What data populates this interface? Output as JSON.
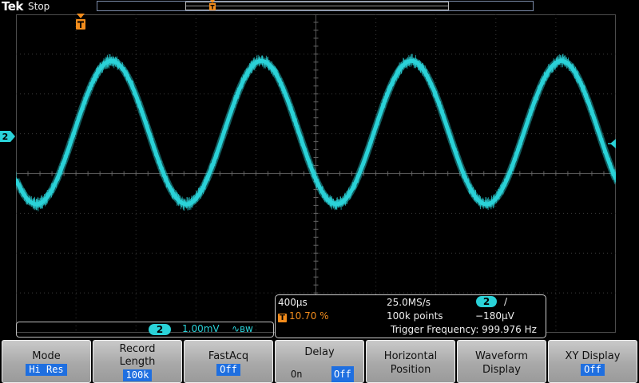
{
  "header": {
    "brand": "Tek",
    "acquisition_state": "Stop"
  },
  "markers": {
    "trigger_position_icon": "T",
    "channel_icon": "2"
  },
  "channel_readout": {
    "channel": "2",
    "volts_per_div": "1.00mV",
    "bandwidth_icon": "∿ʙᴡ"
  },
  "horizontal_readout": {
    "time_per_div": "400µs",
    "trigger_position_icon": "T",
    "trigger_position": "10.70 %",
    "sample_rate": "25.0MS/s",
    "record_points": "100k points",
    "trigger_source": "2",
    "trigger_slope_icon": "∕",
    "trigger_level": "−180µV",
    "trigger_frequency": "Trigger Frequency: 999.976 Hz"
  },
  "menu": {
    "mode": {
      "label": "Mode",
      "value": "Hi Res"
    },
    "record_length": {
      "label_line1": "Record",
      "label_line2": "Length",
      "value": "100k"
    },
    "fastacq": {
      "label": "FastAcq",
      "value": "Off"
    },
    "delay": {
      "label": "Delay",
      "option_on": "On",
      "option_off": "Off"
    },
    "horizontal_position": {
      "label_line1": "Horizontal",
      "label_line2": "Position"
    },
    "waveform_display": {
      "label_line1": "Waveform",
      "label_line2": "Display"
    },
    "xy_display": {
      "label": "XY Display",
      "value": "Off"
    }
  },
  "waveform": {
    "channel": "2",
    "color": "#2ad2d8",
    "shape": "sine",
    "frequency_hz": 999.976,
    "time_per_div_s": 0.0004,
    "volts_per_div_v": 0.001,
    "amplitude_div": 1.8,
    "offset_div": 1.03,
    "horizontal_divs": 10,
    "vertical_divs": 8
  },
  "colors": {
    "channel2": "#2ad2d8",
    "trigger": "#f28c1c",
    "menu_value_bg": "#1f6fe0"
  }
}
